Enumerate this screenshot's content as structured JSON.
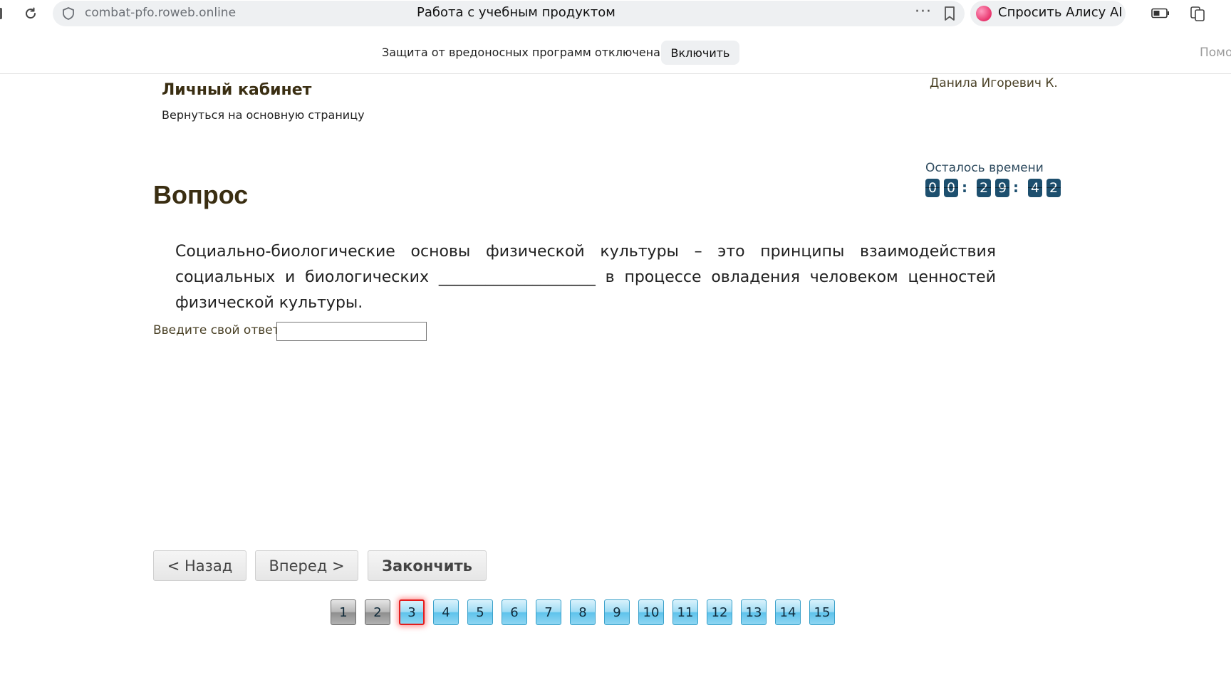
{
  "browser": {
    "url": "combat-pfo.roweb.online",
    "tab_title": "Работа с учебным продуктом",
    "more_label": "···",
    "alice_label": "Спросить Алису AI"
  },
  "notice": {
    "text": "Защита от вредоносных программ отключена",
    "enable_label": "Включить",
    "help_partial": "Помощь"
  },
  "header": {
    "title": "Личный кабинет",
    "back_link": "Вернуться на основную страницу",
    "user_name": "Данила Игоревич К."
  },
  "timer": {
    "label": "Осталось времени",
    "digits": [
      "0",
      "0",
      "2",
      "9",
      "4",
      "2"
    ]
  },
  "question": {
    "heading": "Вопрос",
    "text": "Социально-биологические основы физической культуры – это принципы взаимодействия социальных и биологических ____________________ в процессе овладения человеком ценностей физической культуры.",
    "answer_label": "Введите свой ответ",
    "answer_value": ""
  },
  "navigation": {
    "back_label": "< Назад",
    "next_label": "Вперед >",
    "finish_label": "Закончить"
  },
  "pager": {
    "pages": [
      "1",
      "2",
      "3",
      "4",
      "5",
      "6",
      "7",
      "8",
      "9",
      "10",
      "11",
      "12",
      "13",
      "14",
      "15"
    ],
    "answered": [
      "1",
      "2"
    ],
    "current": "3"
  },
  "colors": {
    "heading_brown": "#3a2e12",
    "timer_digit_bg": "#1d4f6e",
    "page_btn_blue": "#5fc3ec",
    "page_btn_done": "#8f8f8f",
    "current_border": "#e31c1c"
  },
  "icons": [
    "reload-icon",
    "shield-icon",
    "bookmark-icon",
    "alice-icon",
    "battery-icon",
    "cards-icon"
  ]
}
